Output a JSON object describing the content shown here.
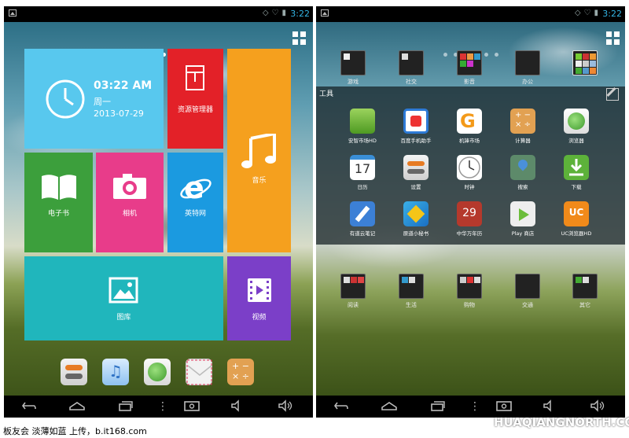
{
  "status_bar": {
    "time": "3:22"
  },
  "left": {
    "clock_tile": {
      "time": "03:22 AM",
      "weekday": "周一",
      "date": "2013-07-29"
    },
    "tiles": {
      "file_manager": "资源管理器",
      "music": "音乐",
      "ebook": "电子书",
      "camera": "相机",
      "internet": "英特网",
      "gallery": "图库",
      "video": "视频"
    },
    "dock": [
      {
        "icon": "settings-toggle-icon"
      },
      {
        "icon": "music-note-icon"
      },
      {
        "icon": "globe-icon"
      },
      {
        "icon": "mail-icon"
      },
      {
        "icon": "calculator-icon"
      }
    ]
  },
  "right": {
    "top_folders": [
      "游戏",
      "社交",
      "影音",
      "办公",
      ""
    ],
    "drawer_title": "工具",
    "apps": [
      [
        "安智市场HD",
        "百度手机助手",
        "机锋市场",
        "计算器",
        "浏览器"
      ],
      [
        "日历",
        "设置",
        "时钟",
        "搜索",
        "下载"
      ],
      [
        "有道云笔记",
        "原道小秘书",
        "中华万年历",
        "Play 商店",
        "UC浏览器HD"
      ]
    ],
    "bottom_folders": [
      "阅读",
      "生活",
      "购物",
      "交通",
      "其它"
    ]
  },
  "footer": {
    "caption": "板友会 淡薄如蓝 上传，b.it168.com",
    "watermark": "HUAQIANGNORTH.COM"
  },
  "colors": {
    "clock": "#58c8ee",
    "file_manager": "#e32128",
    "music": "#f5a01e",
    "ebook": "#3c9f3c",
    "camera": "#e83c8a",
    "internet": "#1b9ae0",
    "gallery": "#20b6bc",
    "video": "#7b3fc8",
    "status_accent": "#33b5e5"
  }
}
